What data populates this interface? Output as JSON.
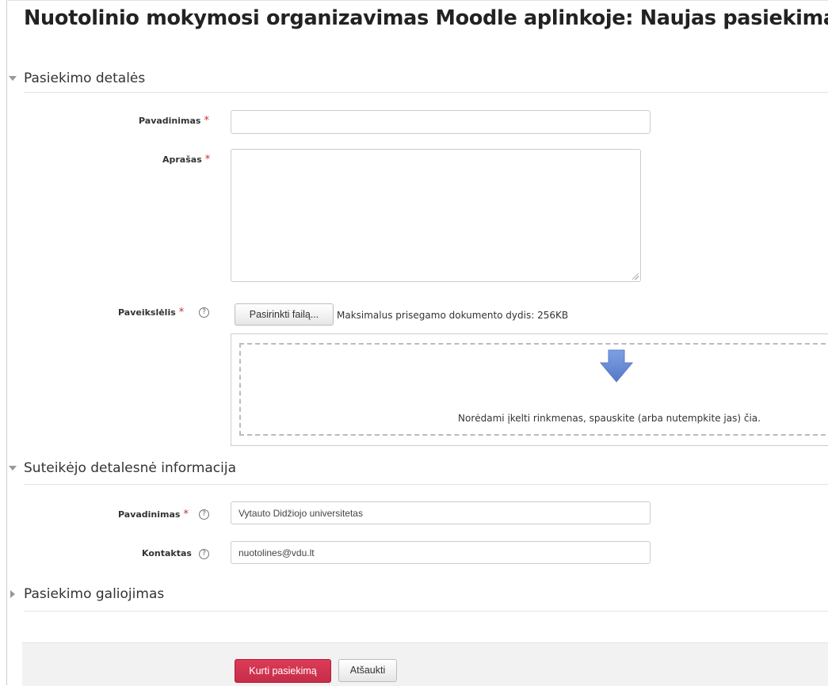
{
  "page": {
    "title": "Nuotolinio mokymosi organizavimas Moodle aplinkoje: Naujas pasiekimas"
  },
  "sections": {
    "details": {
      "title": "Pasiekimo detalės",
      "expanded": true
    },
    "issuer": {
      "title": "Suteikėjo detalesnė informacija",
      "expanded": true
    },
    "expiry": {
      "title": "Pasiekimo galiojimas",
      "expanded": false
    }
  },
  "form": {
    "required_marker": "*",
    "help_glyph": "?",
    "name": {
      "label": "Pavadinimas",
      "value": ""
    },
    "description": {
      "label": "Aprašas",
      "value": ""
    },
    "image": {
      "label": "Paveikslėlis",
      "choose_button": "Pasirinkti failą...",
      "max_size": "Maksimalus prisegamo dokumento dydis: 256KB",
      "drop_hint": "Norėdami įkelti rinkmenas, spauskite (arba nutempkite jas) čia."
    },
    "issuer_name": {
      "label": "Pavadinimas",
      "value": "Vytauto Didžiojo universitetas"
    },
    "contact": {
      "label": "Kontaktas",
      "value": "nuotolines@vdu.lt"
    }
  },
  "actions": {
    "submit": "Kurti pasiekimą",
    "cancel": "Atšaukti"
  },
  "colors": {
    "primary": "#d0334f",
    "required": "#c9302c",
    "drop_arrow": "#6a8fd8",
    "footer_bg": "#f2f2f2"
  },
  "icons": {
    "section_expanded": "triangle-down-icon",
    "section_collapsed": "triangle-right-icon",
    "help": "question-circle-icon",
    "drop": "arrow-down-icon"
  }
}
